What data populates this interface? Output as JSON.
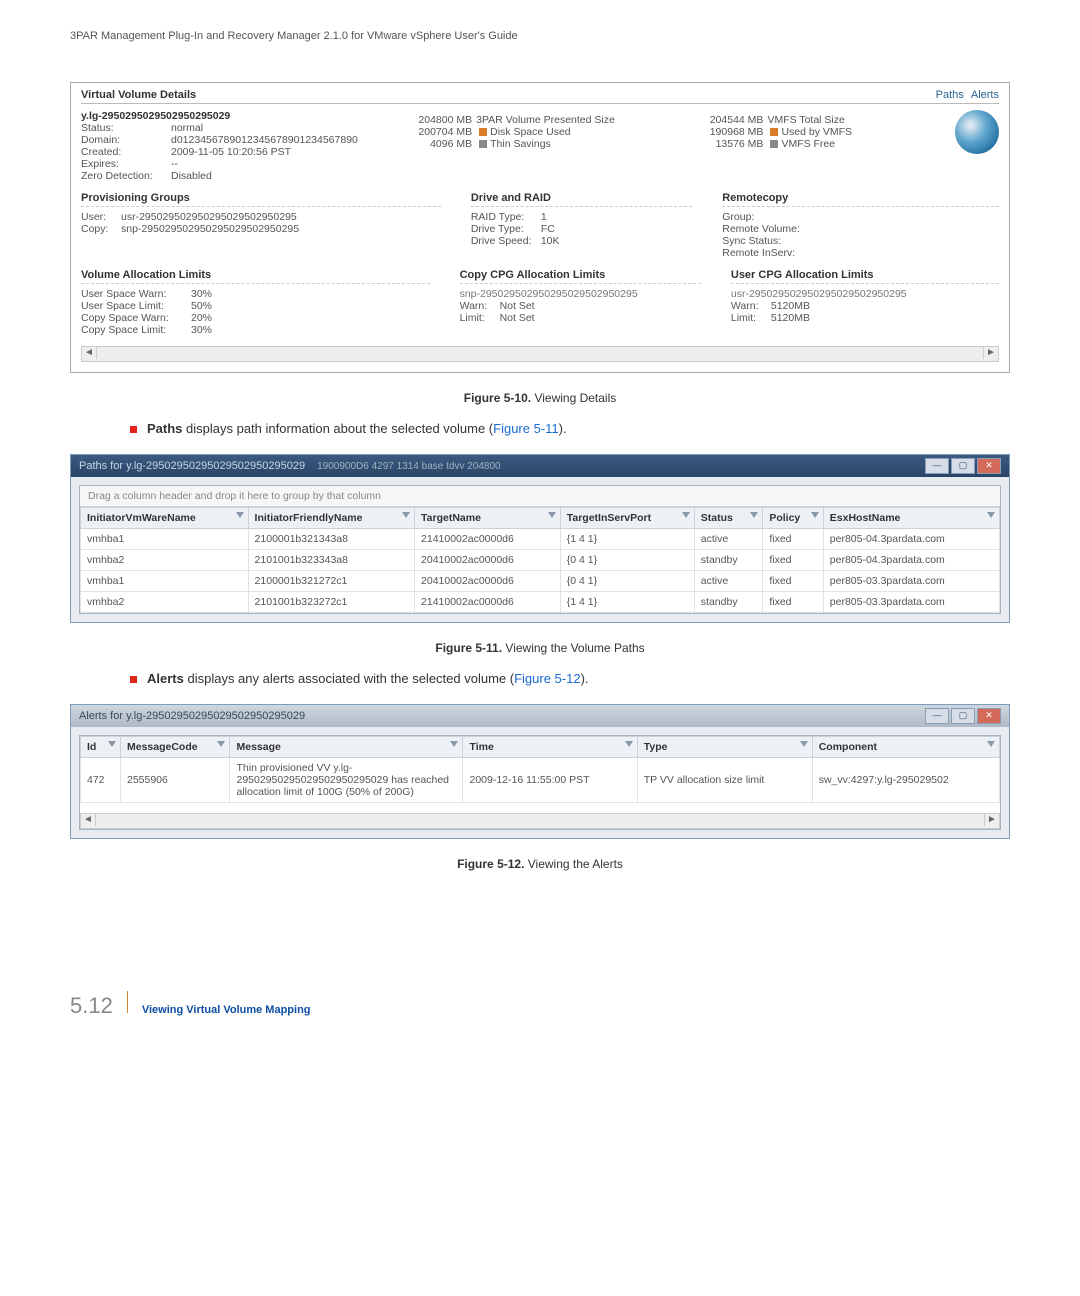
{
  "doc_header": "3PAR Management Plug-In and Recovery Manager 2.1.0 for VMware vSphere User's Guide",
  "vvd": {
    "title": "Virtual Volume Details",
    "links": {
      "paths": "Paths",
      "alerts": "Alerts"
    },
    "vol_name": "y.lg-2950295029502950295029",
    "status_k": "Status:",
    "status_v": "normal",
    "domain_k": "Domain:",
    "domain_v": "d0123456789012345678901234567890",
    "created_k": "Created:",
    "created_v": "2009-11-05 10:20:56 PST",
    "expires_k": "Expires:",
    "expires_v": "--",
    "zero_k": "Zero Detection:",
    "zero_v": "Disabled",
    "presented_size_num": "204800 MB",
    "presented_size_lbl": "3PAR Volume Presented Size",
    "disk_used_num": "200704 MB",
    "disk_used_lbl": "Disk Space Used",
    "thin_num": "4096 MB",
    "thin_lbl": "Thin Savings",
    "vmfs_total_num": "204544 MB",
    "vmfs_total_lbl": "VMFS Total Size",
    "vmfs_used_num": "190968 MB",
    "vmfs_used_lbl": "Used by VMFS",
    "vmfs_free_num": "13576 MB",
    "vmfs_free_lbl": "VMFS Free",
    "prov_groups_h": "Provisioning Groups",
    "user_k": "User:",
    "user_v": "usr-295029502950295029502950295",
    "copy_k": "Copy:",
    "copy_v": "snp-295029502950295029502950295",
    "drive_raid_h": "Drive and RAID",
    "raid_type_k": "RAID Type:",
    "raid_type_v": "1",
    "drive_type_k": "Drive Type:",
    "drive_type_v": "FC",
    "drive_speed_k": "Drive Speed:",
    "drive_speed_v": "10K",
    "remotecopy_h": "Remotecopy",
    "group_k": "Group:",
    "remote_vol_k": "Remote Volume:",
    "sync_k": "Sync Status:",
    "inserv_k": "Remote InServ:",
    "val_h": "Volume Allocation Limits",
    "usw_k": "User Space Warn:",
    "usw_v": "30%",
    "usl_k": "User Space Limit:",
    "usl_v": "50%",
    "csw_k": "Copy Space Warn:",
    "csw_v": "20%",
    "csl_k": "Copy Space Limit:",
    "csl_v": "30%",
    "copy_cpg_h": "Copy CPG Allocation Limits",
    "copy_cpg_sub": "snp-295029502950295029502950295",
    "copy_warn_k": "Warn:",
    "copy_warn_v": "Not Set",
    "copy_limit_k": "Limit:",
    "copy_limit_v": "Not Set",
    "user_cpg_h": "User CPG Allocation Limits",
    "user_cpg_sub": "usr-295029502950295029502950295",
    "user_warn_k": "Warn:",
    "user_warn_v": "5120MB",
    "user_limit_k": "Limit:",
    "user_limit_v": "5120MB"
  },
  "fig10": {
    "label": "Figure 5-10.",
    "caption": "Viewing Details"
  },
  "bullet1": {
    "bold": "Paths",
    "rest": " displays path information about the selected volume (",
    "link": "Figure 5-11",
    "end": ")."
  },
  "paths_win": {
    "title": "Paths for y.lg-29502950295029502950295029",
    "ghost": "1900900D6    4297   1314        base        tdvv       204800",
    "drag_hint": "Drag a column header and drop it here to group by that column",
    "cols": [
      "InitiatorVmWareName",
      "InitiatorFriendlyName",
      "TargetName",
      "TargetInServPort",
      "Status",
      "Policy",
      "EsxHostName"
    ],
    "rows": [
      [
        "vmhba1",
        "2100001b321343a8",
        "21410002ac0000d6",
        "{1 4 1}",
        "active",
        "fixed",
        "per805-04.3pardata.com"
      ],
      [
        "vmhba2",
        "2101001b323343a8",
        "20410002ac0000d6",
        "{0 4 1}",
        "standby",
        "fixed",
        "per805-04.3pardata.com"
      ],
      [
        "vmhba1",
        "2100001b321272c1",
        "20410002ac0000d6",
        "{0 4 1}",
        "active",
        "fixed",
        "per805-03.3pardata.com"
      ],
      [
        "vmhba2",
        "2101001b323272c1",
        "21410002ac0000d6",
        "{1 4 1}",
        "standby",
        "fixed",
        "per805-03.3pardata.com"
      ]
    ]
  },
  "fig11": {
    "label": "Figure 5-11.",
    "caption": "Viewing the Volume Paths"
  },
  "bullet2": {
    "bold": "Alerts",
    "rest": " displays any alerts associated with the selected volume (",
    "link": "Figure 5-12",
    "end": ")."
  },
  "alerts_win": {
    "title": "Alerts for y.lg-29502950295029502950295029",
    "cols": [
      "Id",
      "MessageCode",
      "Message",
      "Time",
      "Type",
      "Component"
    ],
    "row": {
      "id": "472",
      "code": "2555906",
      "msg": "Thin provisioned VV y.lg-29502950295029502950295029 has reached allocation limit of 100G (50% of 200G)",
      "time": "2009-12-16 11:55:00 PST",
      "type": "TP VV allocation size limit",
      "component": "sw_vv:4297:y.lg-295029502"
    }
  },
  "fig12": {
    "label": "Figure 5-12.",
    "caption": "Viewing the Alerts"
  },
  "footer": {
    "num": "5.12",
    "txt": "Viewing Virtual Volume Mapping"
  }
}
